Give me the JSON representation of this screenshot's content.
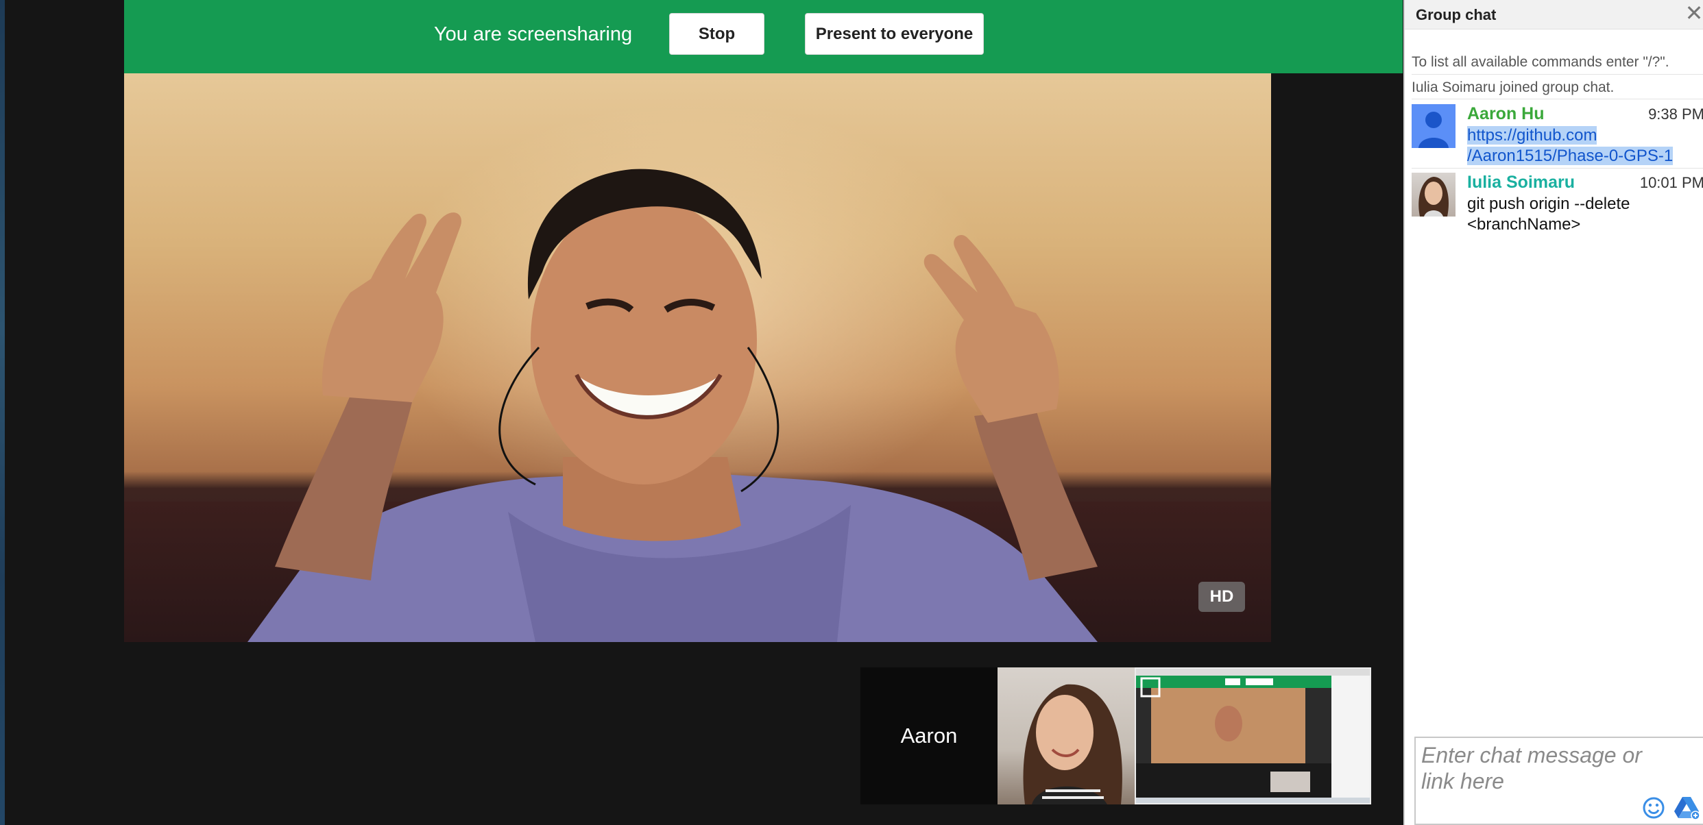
{
  "share_bar": {
    "status_text": "You are screensharing",
    "stop_label": "Stop",
    "present_label": "Present to everyone"
  },
  "main_video": {
    "quality_badge": "HD"
  },
  "thumbnails": {
    "participant_name": "Aaron"
  },
  "chat": {
    "title": "Group chat",
    "close_icon": "close-icon",
    "system_messages": [
      "To list all available commands enter \"/?\".",
      "Iulia Soimaru joined group chat."
    ],
    "messages": [
      {
        "sender": "Aaron Hu",
        "time": "9:38 PM",
        "text_lines": [
          "https://github.com",
          "/Aaron1515/Phase-0-GPS-1"
        ],
        "name_color": "#3aa83a"
      },
      {
        "sender": "Iulia Soimaru",
        "time": "10:01 PM",
        "text_lines": [
          "git push origin --delete",
          "<branchName>"
        ],
        "name_color": "#1ab0a0"
      }
    ],
    "input": {
      "placeholder": "Enter chat message or link here"
    }
  },
  "colors": {
    "share_bar_bg": "#159b52",
    "stage_bg": "#151515",
    "link": "#1155cc"
  }
}
